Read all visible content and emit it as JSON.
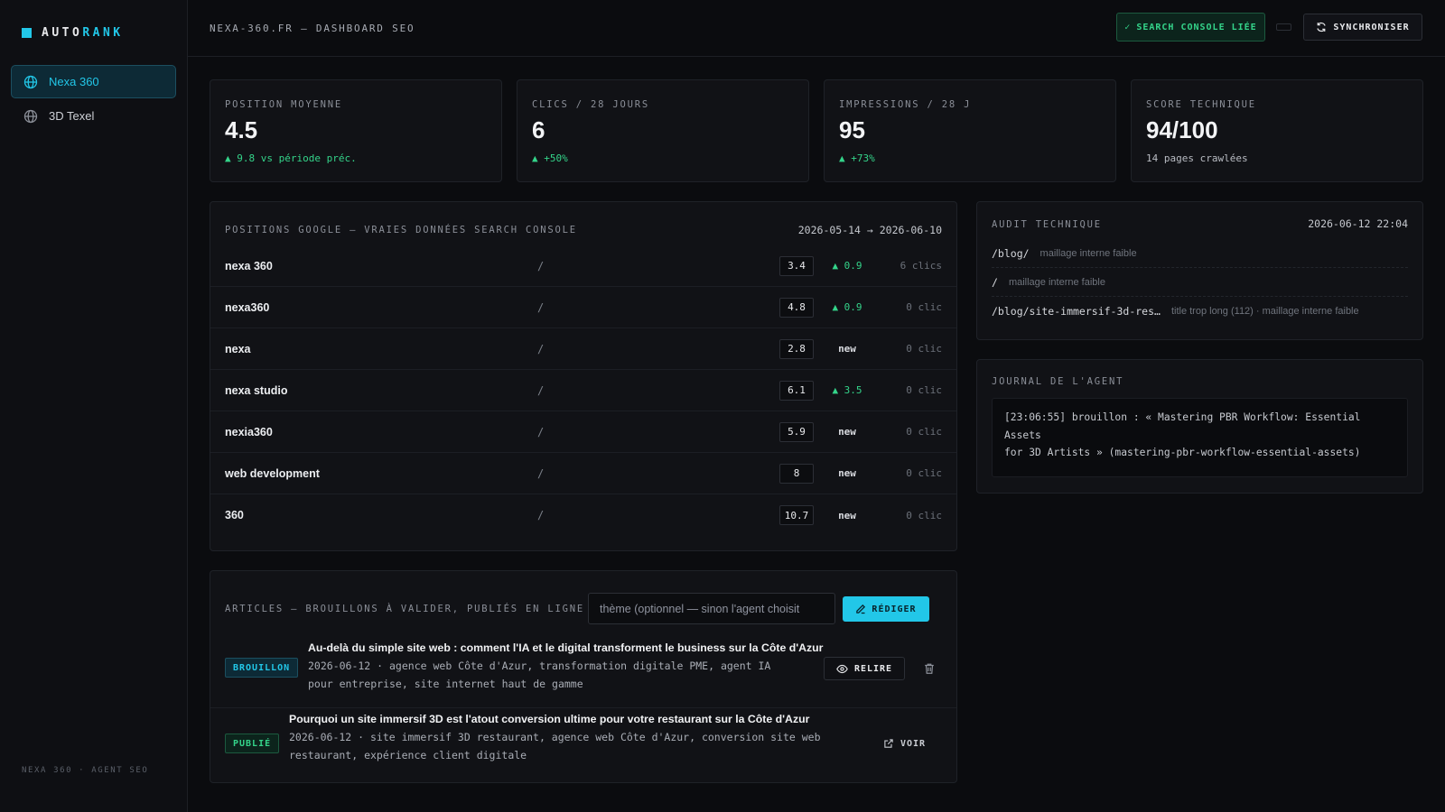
{
  "brand": {
    "part1": "AUTO",
    "part2": "RANK"
  },
  "sidebar": {
    "items": [
      {
        "label": "Nexa 360",
        "icon": "globe-icon",
        "active": true
      },
      {
        "label": "3D Texel",
        "icon": "globe-icon",
        "active": false
      }
    ],
    "footer": "NEXA 360 · AGENT SEO"
  },
  "topbar": {
    "title": "NEXA-360.FR — DASHBOARD SEO",
    "gsc_badge": "SEARCH CONSOLE LIÉE",
    "sync_label": "SYNCHRONISER"
  },
  "kpis": [
    {
      "label": "POSITION MOYENNE",
      "value": "4.5",
      "delta": "▲ 9.8 vs période préc."
    },
    {
      "label": "CLICS / 28 JOURS",
      "value": "6",
      "delta": "▲ +50%"
    },
    {
      "label": "IMPRESSIONS / 28 J",
      "value": "95",
      "delta": "▲ +73%"
    },
    {
      "label": "SCORE TECHNIQUE",
      "value": "94/100",
      "delta": "14 pages crawlées"
    }
  ],
  "positions": {
    "title": "POSITIONS GOOGLE — VRAIES DONNÉES SEARCH CONSOLE",
    "range": "2026-05-14 → 2026-06-10",
    "rows": [
      {
        "query": "nexa 360",
        "path": "/",
        "position": "3.4",
        "trend": "▲ 0.9",
        "clicks": "6 clics"
      },
      {
        "query": "nexa360",
        "path": "/",
        "position": "4.8",
        "trend": "▲ 0.9",
        "clicks": "0 clic"
      },
      {
        "query": "nexa",
        "path": "/",
        "position": "2.8",
        "trend": "new",
        "clicks": "0 clic"
      },
      {
        "query": "nexa studio",
        "path": "/",
        "position": "6.1",
        "trend": "▲ 3.5",
        "clicks": "0 clic"
      },
      {
        "query": "nexia360",
        "path": "/",
        "position": "5.9",
        "trend": "new",
        "clicks": "0 clic"
      },
      {
        "query": "web development",
        "path": "/",
        "position": "8",
        "trend": "new",
        "clicks": "0 clic"
      },
      {
        "query": "360",
        "path": "/",
        "position": "10.7",
        "trend": "new",
        "clicks": "0 clic"
      }
    ]
  },
  "articles": {
    "title": "ARTICLES — BROUILLONS À VALIDER, PUBLIÉS EN LIGNE",
    "input_placeholder": "thème (optionnel — sinon l'agent choisit",
    "redact_label": "RÉDIGER",
    "items": [
      {
        "status": "BROUILLON",
        "title": "Au-delà du simple site web : comment l'IA et le digital transforment le business sur la Côte d'Azur",
        "meta_line1": "2026-06-12 · agence web Côte d'Azur, transformation digitale PME, agent IA",
        "meta_line2": "pour entreprise, site internet haut de gamme",
        "action": "RELIRE"
      },
      {
        "status": "PUBLIÉ",
        "title": "Pourquoi un site immersif 3D est l'atout conversion ultime pour votre restaurant sur la Côte d'Azur",
        "meta_line1": "2026-06-12 · site immersif 3D restaurant, agence web Côte d'Azur, conversion site web",
        "meta_line2": "restaurant, expérience client digitale",
        "action": "VOIR"
      }
    ]
  },
  "audit": {
    "title": "AUDIT TECHNIQUE",
    "date": "2026-06-12 22:04",
    "rows": [
      {
        "path": "/blog/",
        "issue": "maillage interne faible"
      },
      {
        "path": "/",
        "issue": "maillage interne faible"
      },
      {
        "path": "/blog/site-immersif-3d-res…",
        "issue": "title trop long (112) · maillage interne faible"
      }
    ]
  },
  "journal": {
    "title": "JOURNAL DE L'AGENT",
    "line1": "[23:06:55] brouillon : « Mastering PBR Workflow: Essential Assets",
    "line2": "for 3D Artists » (mastering-pbr-workflow-essential-assets)"
  },
  "colors": {
    "accent": "#22c7e8",
    "success": "#34d48a",
    "background": "#0b0c0f"
  }
}
